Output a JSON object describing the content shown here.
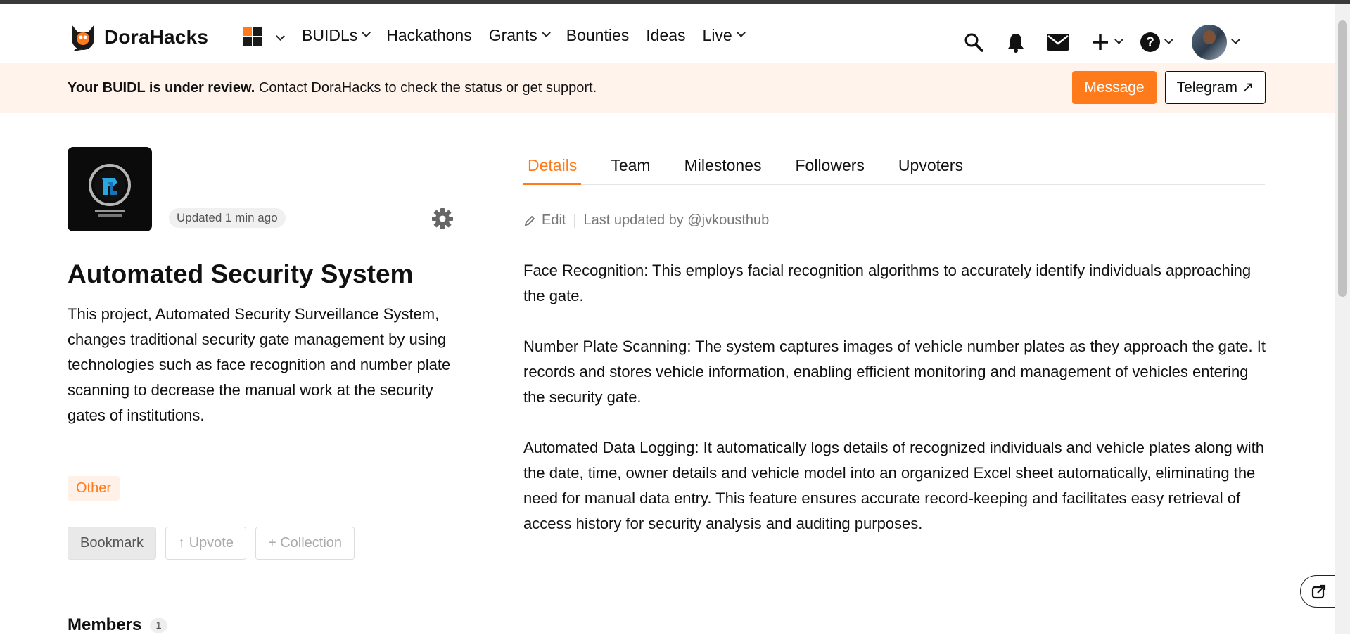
{
  "header": {
    "brand": "DoraHacks",
    "nav": [
      {
        "label": "BUIDLs",
        "dropdown": true
      },
      {
        "label": "Hackathons",
        "dropdown": false
      },
      {
        "label": "Grants",
        "dropdown": true
      },
      {
        "label": "Bounties",
        "dropdown": false
      },
      {
        "label": "Ideas",
        "dropdown": false
      },
      {
        "label": "Live",
        "dropdown": true
      }
    ],
    "icons": [
      "search-icon",
      "bell-icon",
      "mail-icon",
      "plus-icon",
      "help-icon",
      "avatar"
    ],
    "accent": "#ff7a1a"
  },
  "banner": {
    "bold": "Your BUIDL is under review.",
    "text": " Contact DoraHacks to check the status or get support.",
    "message_btn": "Message",
    "telegram_btn": "Telegram ↗"
  },
  "project": {
    "updated": "Updated 1 min ago",
    "title": "Automated Security System",
    "description": "This project, Automated Security Surveillance System, changes traditional security gate management by using technologies such as face recognition and number plate scanning to decrease the manual work at the security gates of institutions.",
    "tag": "Other",
    "bookmark": "Bookmark",
    "upvote": "↑ Upvote",
    "collection": "+ Collection",
    "members_label": "Members",
    "members_count": "1"
  },
  "tabs": [
    "Details",
    "Team",
    "Milestones",
    "Followers",
    "Upvoters"
  ],
  "active_tab": "Details",
  "edit": {
    "label": "Edit",
    "last_updated": "Last updated by @jvkousthub"
  },
  "details": [
    "Face Recognition: This employs facial recognition algorithms to accurately identify individuals approaching the gate.",
    "Number Plate Scanning: The system captures images of vehicle number plates as they approach the gate. It records and stores vehicle information, enabling efficient monitoring and management of vehicles entering the security gate.",
    "Automated Data Logging: It automatically logs details of recognized individuals and vehicle plates along with the date, time, owner details and vehicle model into an organized Excel sheet automatically, eliminating the need for manual data entry. This feature ensures accurate record-keeping and facilitates easy retrieval of access history for security analysis and auditing purposes."
  ]
}
